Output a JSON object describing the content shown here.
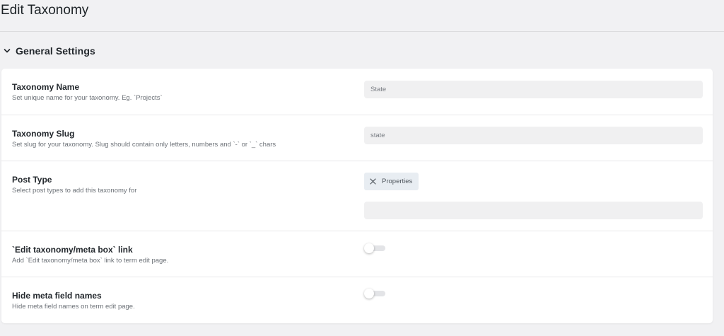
{
  "page": {
    "title": "Edit Taxonomy"
  },
  "section": {
    "title": "General Settings",
    "icon": "chevron-down-icon"
  },
  "fields": {
    "taxonomy_name": {
      "label": "Taxonomy Name",
      "description": "Set unique name for your taxonomy. Eg. `Projects`",
      "value": "State"
    },
    "taxonomy_slug": {
      "label": "Taxonomy Slug",
      "description": "Set slug for your taxonomy. Slug should contain only letters, numbers and `-` or `_` chars",
      "value": "state"
    },
    "post_type": {
      "label": "Post Type",
      "description": "Select post types to add this taxonomy for",
      "selected": [
        "Properties"
      ],
      "search_value": ""
    },
    "edit_link": {
      "label": "`Edit taxonomy/meta box` link",
      "description": "Add `Edit taxonomy/meta box` link to term edit page.",
      "enabled": false
    },
    "hide_meta_names": {
      "label": "Hide meta field names",
      "description": "Hide meta field names on term edit page.",
      "enabled": false
    }
  }
}
